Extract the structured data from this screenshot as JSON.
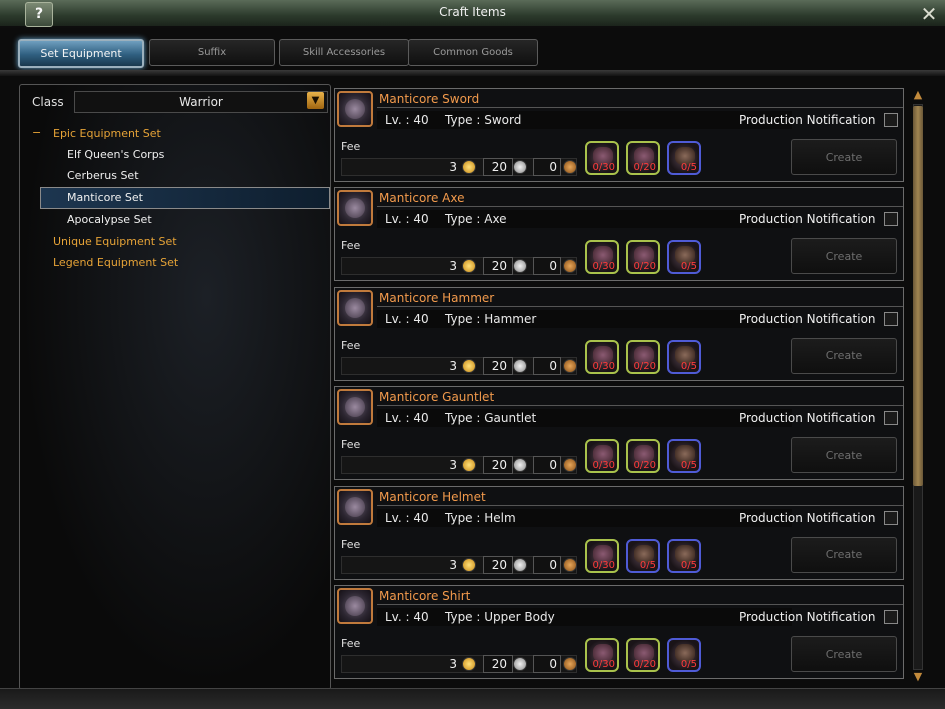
{
  "window": {
    "title": "Craft Items",
    "help_label": "?",
    "close_label": "✕"
  },
  "tabs": [
    {
      "label": "Set Equipment",
      "active": true
    },
    {
      "label": "Suffix",
      "active": false
    },
    {
      "label": "Skill Accessories",
      "active": false
    },
    {
      "label": "Common Goods",
      "active": false
    }
  ],
  "filter": {
    "class_label": "Class",
    "class_value": "Warrior",
    "dropdown_icon": "chevron-down-icon"
  },
  "tree": {
    "epic": {
      "toggle": "−",
      "label": "Epic Equipment Set"
    },
    "epic_items": [
      "Elf Queen's Corps",
      "Cerberus Set",
      "Manticore Set",
      "Apocalypse Set"
    ],
    "selected": "Manticore Set",
    "unique": "Unique Equipment Set",
    "legend": "Legend Equipment Set"
  },
  "labels": {
    "fee": "Fee",
    "notification": "Production Notification",
    "create": "Create"
  },
  "recipes": [
    {
      "name": "Manticore Sword",
      "level": "Lv. : 40",
      "type": "Type : Sword",
      "gold": "3",
      "silver": "20",
      "copper": "0",
      "materials": [
        {
          "count": "0/30",
          "grade": "green"
        },
        {
          "count": "0/20",
          "grade": "green"
        },
        {
          "count": "0/5",
          "grade": "blue"
        }
      ]
    },
    {
      "name": "Manticore Axe",
      "level": "Lv. : 40",
      "type": "Type : Axe",
      "gold": "3",
      "silver": "20",
      "copper": "0",
      "materials": [
        {
          "count": "0/30",
          "grade": "green"
        },
        {
          "count": "0/20",
          "grade": "green"
        },
        {
          "count": "0/5",
          "grade": "blue"
        }
      ]
    },
    {
      "name": "Manticore Hammer",
      "level": "Lv. : 40",
      "type": "Type : Hammer",
      "gold": "3",
      "silver": "20",
      "copper": "0",
      "materials": [
        {
          "count": "0/30",
          "grade": "green"
        },
        {
          "count": "0/20",
          "grade": "green"
        },
        {
          "count": "0/5",
          "grade": "blue"
        }
      ]
    },
    {
      "name": "Manticore Gauntlet",
      "level": "Lv. : 40",
      "type": "Type : Gauntlet",
      "gold": "3",
      "silver": "20",
      "copper": "0",
      "materials": [
        {
          "count": "0/30",
          "grade": "green"
        },
        {
          "count": "0/20",
          "grade": "green"
        },
        {
          "count": "0/5",
          "grade": "blue"
        }
      ]
    },
    {
      "name": "Manticore Helmet",
      "level": "Lv. : 40",
      "type": "Type : Helm",
      "gold": "3",
      "silver": "20",
      "copper": "0",
      "materials": [
        {
          "count": "0/30",
          "grade": "green"
        },
        {
          "count": "0/5",
          "grade": "blue"
        },
        {
          "count": "0/5",
          "grade": "blue"
        }
      ]
    },
    {
      "name": "Manticore Shirt",
      "level": "Lv. : 40",
      "type": "Type : Upper Body",
      "gold": "3",
      "silver": "20",
      "copper": "0",
      "materials": [
        {
          "count": "0/30",
          "grade": "green"
        },
        {
          "count": "0/20",
          "grade": "green"
        },
        {
          "count": "0/5",
          "grade": "blue"
        }
      ]
    }
  ],
  "scroll": {
    "up_icon": "▲",
    "down_icon": "▼"
  }
}
